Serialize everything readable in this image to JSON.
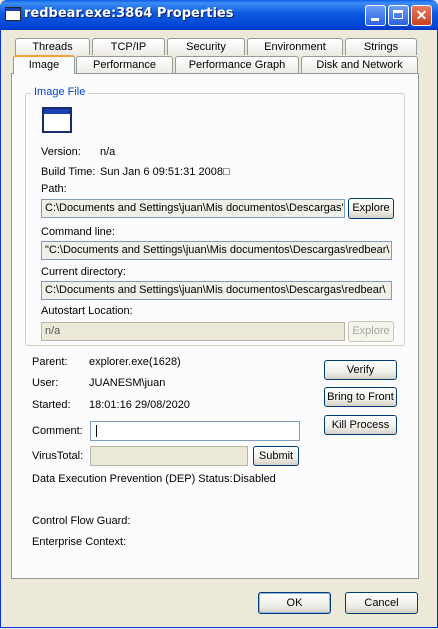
{
  "window": {
    "title": "redbear.exe:3864 Properties"
  },
  "tabs_row1": [
    "Threads",
    "TCP/IP",
    "Security",
    "Environment",
    "Strings"
  ],
  "tabs_row2": [
    "Image",
    "Performance",
    "Performance Graph",
    "Disk and Network"
  ],
  "image_file": {
    "group_label": "Image File",
    "version_label": "Version:",
    "version_value": "n/a",
    "build_label": "Build Time:",
    "build_value": "Sun Jan  6 09:51:31 2008□",
    "path_label": "Path:",
    "path_value": "C:\\Documents and Settings\\juan\\Mis documentos\\Descargas'",
    "path_button": "Explore",
    "cmd_label": "Command line:",
    "cmd_value": "\"C:\\Documents and Settings\\juan\\Mis documentos\\Descargas\\redbear\\",
    "dir_label": "Current directory:",
    "dir_value": "C:\\Documents and Settings\\juan\\Mis documentos\\Descargas\\redbear\\",
    "autostart_label": "Autostart Location:",
    "autostart_value": "n/a",
    "autostart_button": "Explore"
  },
  "process": {
    "parent_label": "Parent:",
    "parent_value": "explorer.exe(1628)",
    "user_label": "User:",
    "user_value": "JUANESM\\juan",
    "started_label": "Started:",
    "started_value": "18:01:16   29/08/2020",
    "comment_label": "Comment:",
    "comment_value": "",
    "virustotal_label": "VirusTotal:",
    "virustotal_value": "",
    "submit_button": "Submit",
    "dep_label": "Data Execution Prevention (DEP) Status:",
    "dep_value": "Disabled",
    "cfg_label": "Control Flow Guard:",
    "enterprise_label": "Enterprise Context:"
  },
  "actions": {
    "verify": "Verify",
    "bring_to_front": "Bring to Front",
    "kill_process": "Kill Process"
  },
  "footer": {
    "ok": "OK",
    "cancel": "Cancel"
  }
}
